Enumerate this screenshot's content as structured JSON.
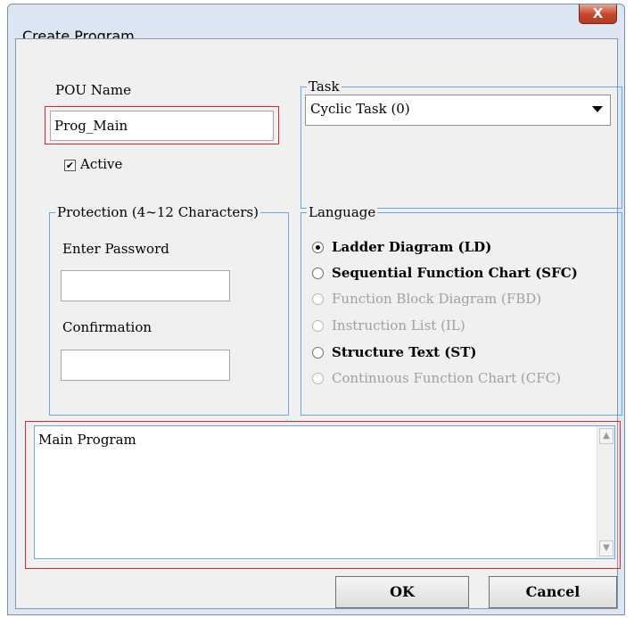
{
  "window": {
    "title": "Create Program"
  },
  "pou": {
    "label": "POU Name",
    "value": "Prog_Main",
    "active_label": "Active",
    "active_checked": true
  },
  "task": {
    "title": "Task",
    "selected": "Cyclic Task (0)"
  },
  "protection": {
    "title": "Protection (4~12 Characters)",
    "password_label": "Enter Password",
    "password_value": "",
    "confirm_label": "Confirmation",
    "confirm_value": ""
  },
  "language": {
    "title": "Language",
    "options": [
      {
        "label": "Ladder Diagram (LD)",
        "checked": true,
        "enabled": true
      },
      {
        "label": "Sequential Function Chart (SFC)",
        "checked": false,
        "enabled": true
      },
      {
        "label": "Function Block Diagram (FBD)",
        "checked": false,
        "enabled": false
      },
      {
        "label": "Instruction List (IL)",
        "checked": false,
        "enabled": false
      },
      {
        "label": "Structure Text (ST)",
        "checked": false,
        "enabled": true
      },
      {
        "label": "Continuous Function Chart (CFC)",
        "checked": false,
        "enabled": false
      }
    ]
  },
  "description": {
    "value": "Main Program"
  },
  "buttons": {
    "ok": "OK",
    "cancel": "Cancel"
  },
  "icons": {
    "close": "close-icon",
    "dropdown": "dropdown-arrow-icon",
    "checkbox": "checkmark-icon"
  },
  "colors": {
    "highlight": "#e0242a",
    "group_border": "#6aa6e6",
    "close_button": "#c5452a"
  }
}
